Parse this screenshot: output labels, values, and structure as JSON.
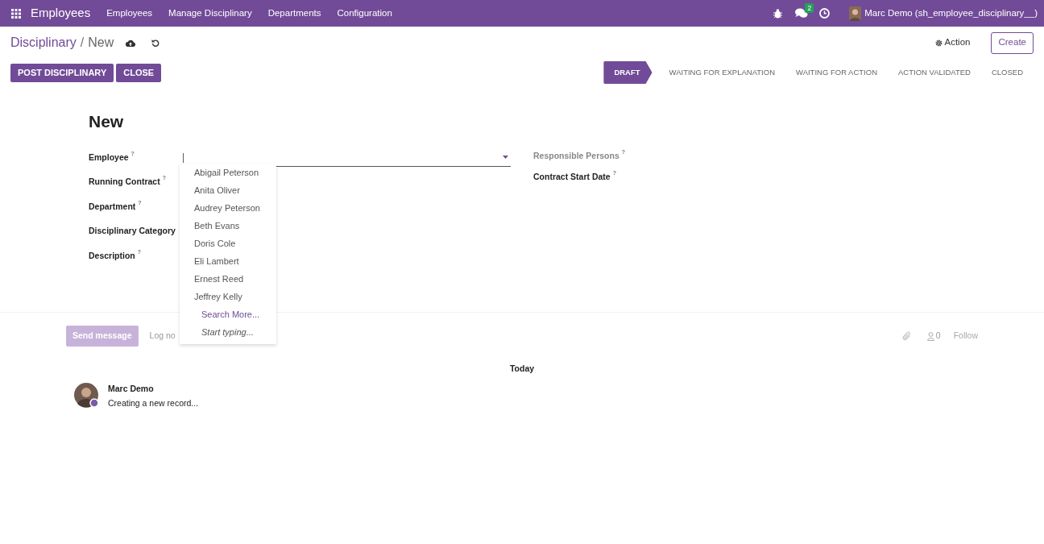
{
  "navbar": {
    "app_name": "Employees",
    "menu": [
      "Employees",
      "Manage Disciplinary",
      "Departments",
      "Configuration"
    ],
    "message_count": "2",
    "user": "Marc Demo (sh_employee_disciplinary__)"
  },
  "breadcrumb": {
    "parent": "Disciplinary",
    "separator": "/",
    "current": "New"
  },
  "control_panel": {
    "action": "Action",
    "create": "Create"
  },
  "buttons": [
    "POST DISCIPLINARY",
    "CLOSE"
  ],
  "stages": [
    {
      "label": "DRAFT",
      "selected": true
    },
    {
      "label": "WAITING FOR EXPLANATION",
      "selected": false
    },
    {
      "label": "WAITING FOR ACTION",
      "selected": false
    },
    {
      "label": "ACTION VALIDATED",
      "selected": false
    },
    {
      "label": "CLOSED",
      "selected": false
    }
  ],
  "form": {
    "title": "New",
    "left_fields": [
      {
        "label": "Employee",
        "help": "?"
      },
      {
        "label": "Running Contract",
        "help": "?"
      },
      {
        "label": "Department",
        "help": "?"
      },
      {
        "label": "Disciplinary Category"
      },
      {
        "label": "Description",
        "help": "?"
      }
    ],
    "right_fields": [
      {
        "label": "Responsible Persons",
        "help": "?",
        "muted": true
      },
      {
        "label": "Contract Start Date",
        "help": "?",
        "muted": false
      }
    ],
    "employee_input": {
      "value": "|"
    }
  },
  "dropdown": {
    "options": [
      "Abigail Peterson",
      "Anita Oliver",
      "Audrey Peterson",
      "Beth Evans",
      "Doris Cole",
      "Eli Lambert",
      "Ernest Reed",
      "Jeffrey Kelly"
    ],
    "search_more": "Search More...",
    "start_typing": "Start typing..."
  },
  "chatter": {
    "send": "Send message",
    "log": "Log no",
    "followers": "0",
    "follow": "Follow",
    "date": "Today",
    "messages": [
      {
        "author": "Marc Demo",
        "text": "Creating a new record..."
      }
    ]
  }
}
